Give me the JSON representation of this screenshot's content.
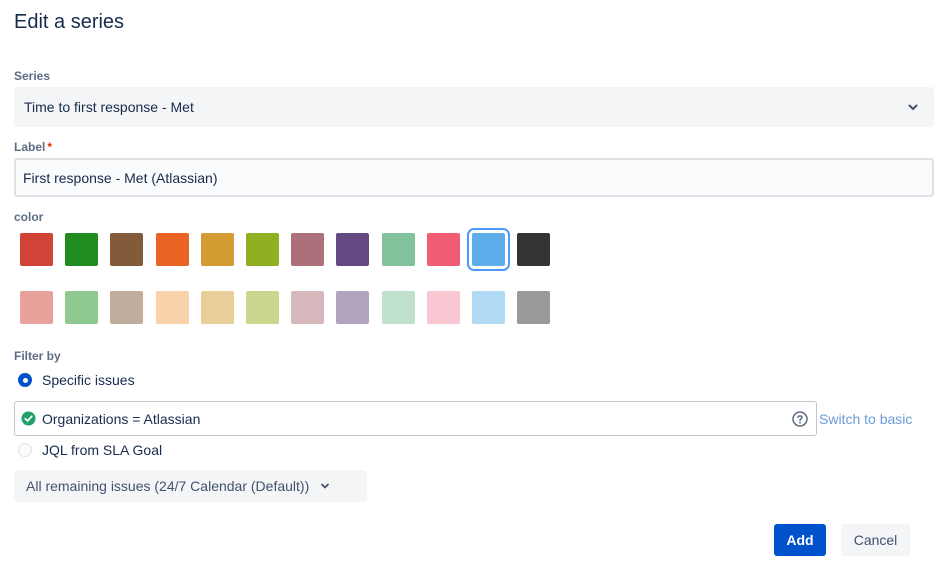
{
  "dialog": {
    "title": "Edit a series"
  },
  "series": {
    "label": "Series",
    "value": "Time to first response - Met",
    "icon": "chevron-down-icon"
  },
  "label_field": {
    "label": "Label",
    "required_marker": "*",
    "value": "First response - Met (Atlassian)"
  },
  "color": {
    "label": "color",
    "selected": "#5cadea",
    "row1": [
      "#d04437",
      "#218c22",
      "#815b3a",
      "#e96325",
      "#d39c32",
      "#8eb021",
      "#ac707a",
      "#654982",
      "#81c29d",
      "#f15c75",
      "#5cadea",
      "#333333"
    ],
    "row2": [
      "#e8a19b",
      "#8ec98f",
      "#c0ad9b",
      "#f9d1aa",
      "#e9ce9a",
      "#cad88f",
      "#d6b7bc",
      "#b2a4c1",
      "#c0e1ce",
      "#f9c7d2",
      "#b0d9f3",
      "#999999"
    ]
  },
  "filter": {
    "label": "Filter by",
    "option_specific": "Specific issues",
    "jql_value": "Organizations = Atlassian",
    "jql_status_icon": "check-circle-icon",
    "help_icon": "question-circle-icon",
    "switch_link": "Switch to basic",
    "option_sla": "JQL from SLA Goal",
    "calendar_button": "All remaining issues (24/7 Calendar (Default))"
  },
  "actions": {
    "add": "Add",
    "cancel": "Cancel"
  },
  "colors": {
    "primary": "#0052cc",
    "link": "#6b9bd8",
    "selection_ring": "#4c9aff"
  }
}
